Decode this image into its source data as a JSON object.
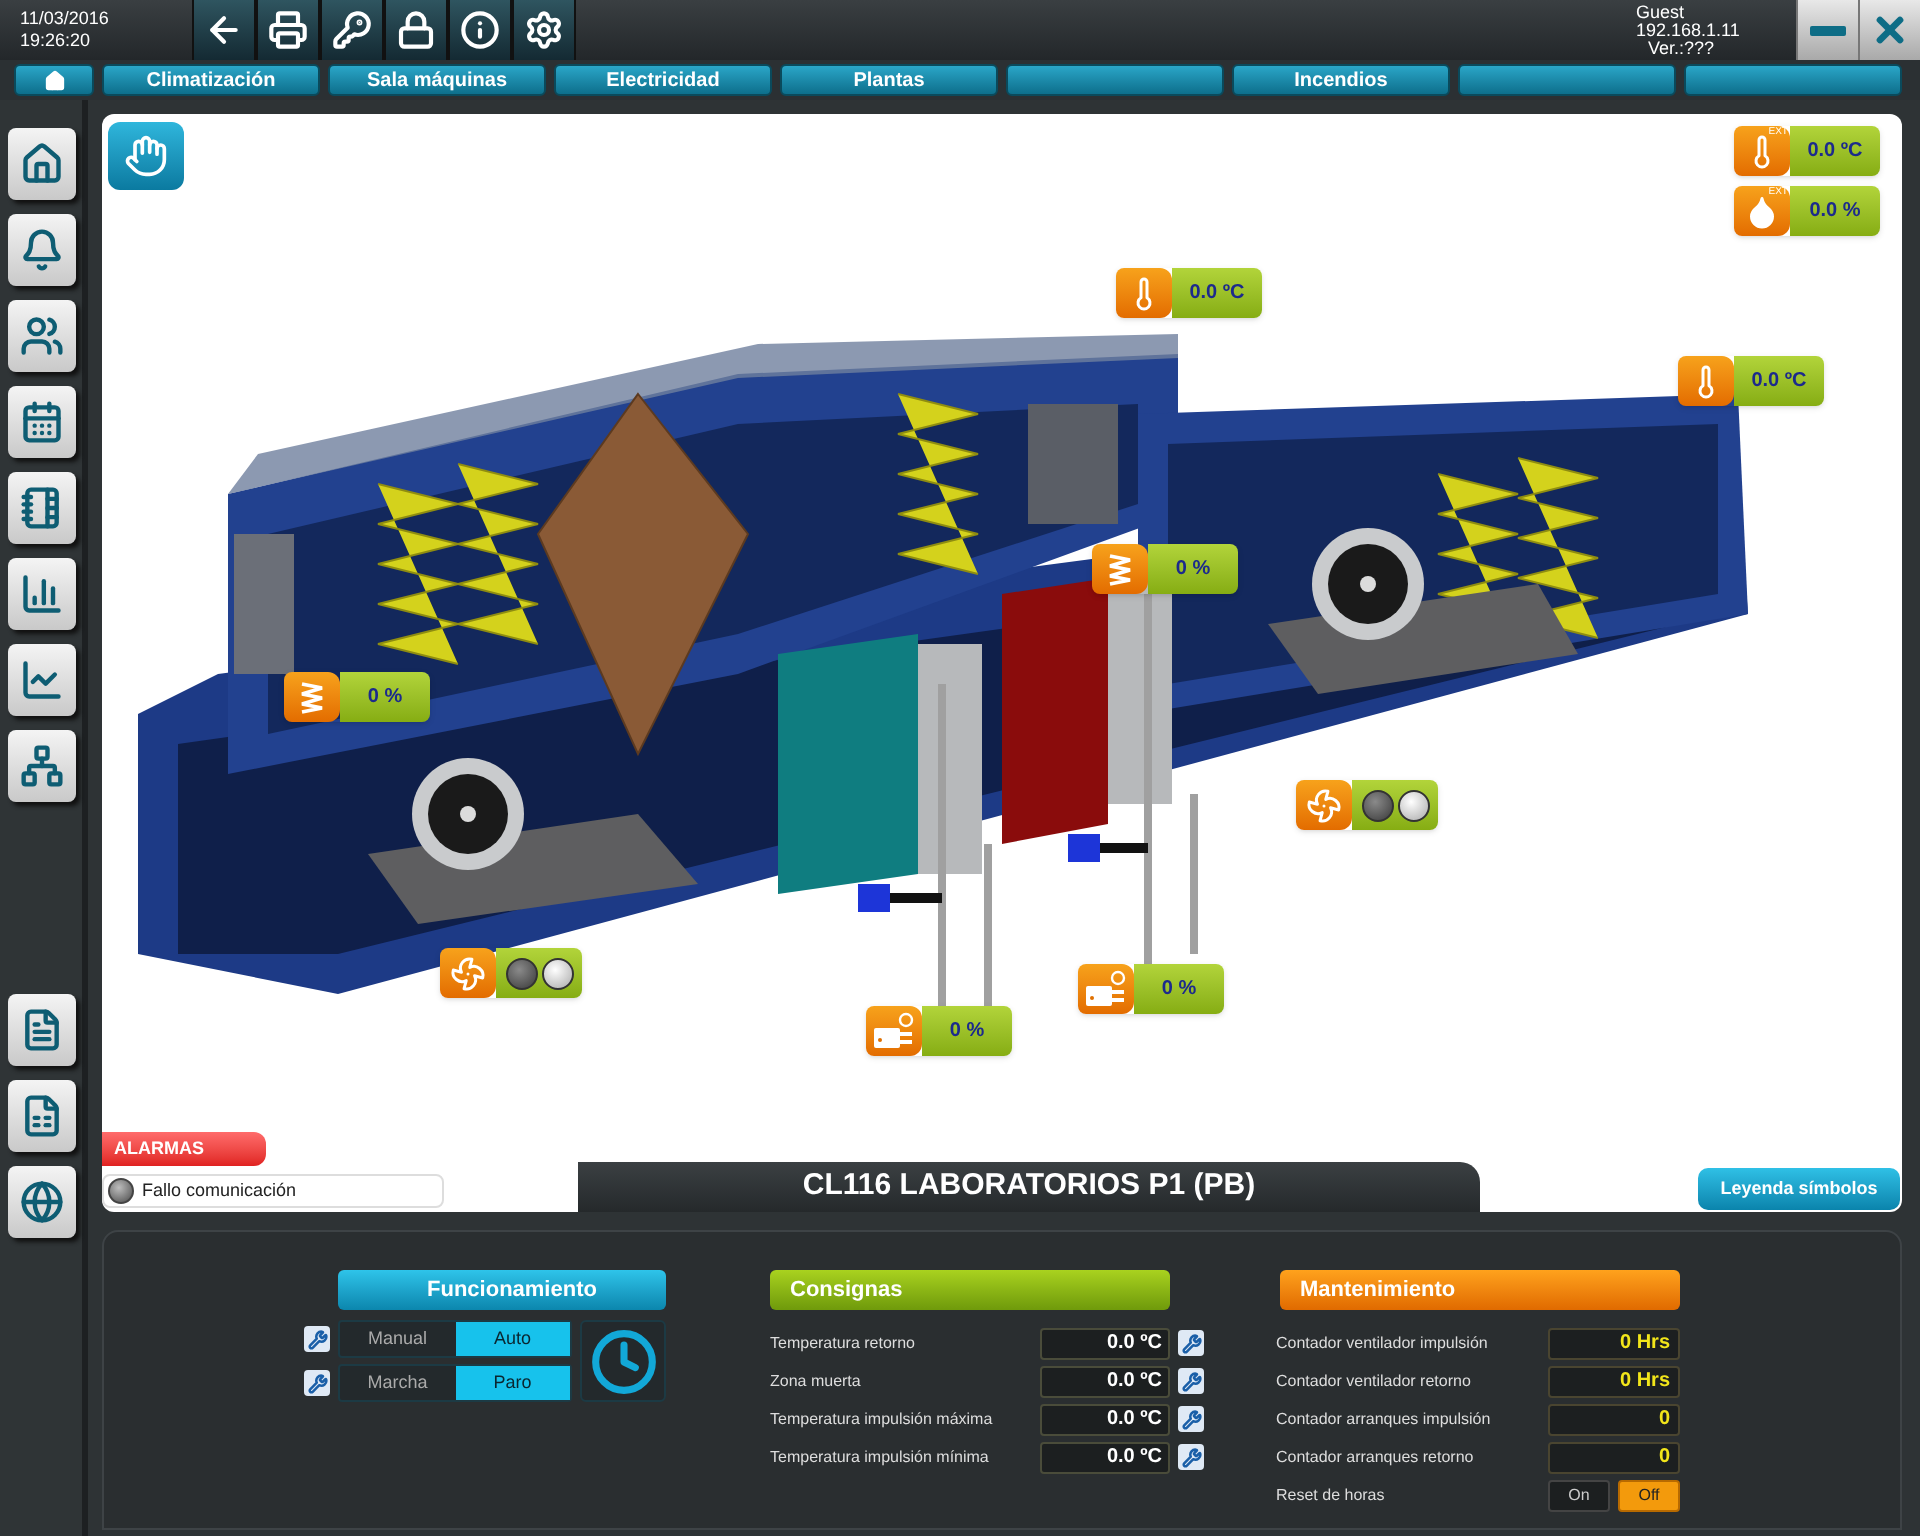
{
  "header": {
    "date": "11/03/2016",
    "time": "19:26:20",
    "user": "Guest",
    "ip": "192.168.1.11",
    "version": "Ver.:???"
  },
  "toolbar": [
    {
      "kind": "back"
    },
    {
      "kind": "print"
    },
    {
      "kind": "key"
    },
    {
      "kind": "lock"
    },
    {
      "kind": "info"
    },
    {
      "kind": "settings"
    }
  ],
  "window_buttons": [
    {
      "kind": "minimize"
    },
    {
      "kind": "close"
    }
  ],
  "nav_tabs": [
    {
      "kind": "home"
    },
    {
      "kind": "text",
      "label": "Climatización"
    },
    {
      "kind": "text",
      "label": "Sala máquinas"
    },
    {
      "kind": "text",
      "label": "Electricidad"
    },
    {
      "kind": "text",
      "label": "Plantas"
    },
    {
      "kind": "blank"
    },
    {
      "kind": "text",
      "label": "Incendios"
    },
    {
      "kind": "blank"
    },
    {
      "kind": "blank"
    }
  ],
  "sidebar": [
    {
      "kind": "home"
    },
    {
      "kind": "alarm"
    },
    {
      "kind": "users"
    },
    {
      "kind": "calendar"
    },
    {
      "kind": "notebook"
    },
    {
      "kind": "bars"
    },
    {
      "kind": "trend"
    },
    {
      "kind": "network"
    },
    {
      "kind": "spacer"
    },
    {
      "kind": "document"
    },
    {
      "kind": "spreadsheet"
    },
    {
      "kind": "globe"
    }
  ],
  "sensors": [
    {
      "kind": "temp_ext",
      "tag": "EXT",
      "value": "0.0 ºC"
    },
    {
      "kind": "humidity_ext",
      "tag": "EXT",
      "value": "0.0 %"
    },
    {
      "kind": "temp_return",
      "value": "0.0 ºC"
    },
    {
      "kind": "temp_supply",
      "value": "0.0 ºC"
    },
    {
      "kind": "damper",
      "value": "0 %"
    },
    {
      "kind": "damper",
      "value": "0 %"
    },
    {
      "kind": "fan",
      "lamps": [
        {
          "on": false
        },
        {
          "on": true
        }
      ]
    },
    {
      "kind": "fan",
      "lamps": [
        {
          "on": false
        },
        {
          "on": true
        }
      ]
    },
    {
      "kind": "valve_heat",
      "value": "0 %"
    },
    {
      "kind": "valve_cool",
      "value": "0 %"
    }
  ],
  "alarms": {
    "title": "ALARMAS",
    "items": [
      {
        "text": "Fallo comunicación",
        "active": false
      }
    ]
  },
  "title": "CL116 LABORATORIOS P1 (PB)",
  "legend_button": "Leyenda símbolos",
  "funcionamiento": {
    "title": "Funcionamiento",
    "toggles": [
      {
        "options": [
          {
            "label": "Manual",
            "selected": false
          },
          {
            "label": "Auto",
            "selected": true
          }
        ]
      },
      {
        "options": [
          {
            "label": "Marcha",
            "selected": false
          },
          {
            "label": "Paro",
            "selected": true
          }
        ]
      }
    ]
  },
  "consignas": {
    "title": "Consignas",
    "rows": [
      {
        "label": "Temperatura retorno",
        "value": "0.0 ºC"
      },
      {
        "label": "Zona muerta",
        "value": "0.0 ºC"
      },
      {
        "label": "Temperatura impulsión máxima",
        "value": "0.0 ºC"
      },
      {
        "label": "Temperatura impulsión mínima",
        "value": "0.0 ºC"
      }
    ]
  },
  "mantenimiento": {
    "title": "Mantenimiento",
    "rows": [
      {
        "kind": "counter",
        "label": "Contador ventilador impulsión",
        "value": "0 Hrs"
      },
      {
        "kind": "counter",
        "label": "Contador ventilador retorno",
        "value": "0 Hrs"
      },
      {
        "kind": "counter",
        "label": "Contador arranques impulsión",
        "value": "0"
      },
      {
        "kind": "counter",
        "label": "Contador arranques retorno",
        "value": "0"
      },
      {
        "kind": "switch",
        "label": "Reset de horas",
        "options": [
          {
            "label": "On",
            "selected": false
          },
          {
            "label": "Off",
            "selected": true
          }
        ]
      }
    ]
  }
}
